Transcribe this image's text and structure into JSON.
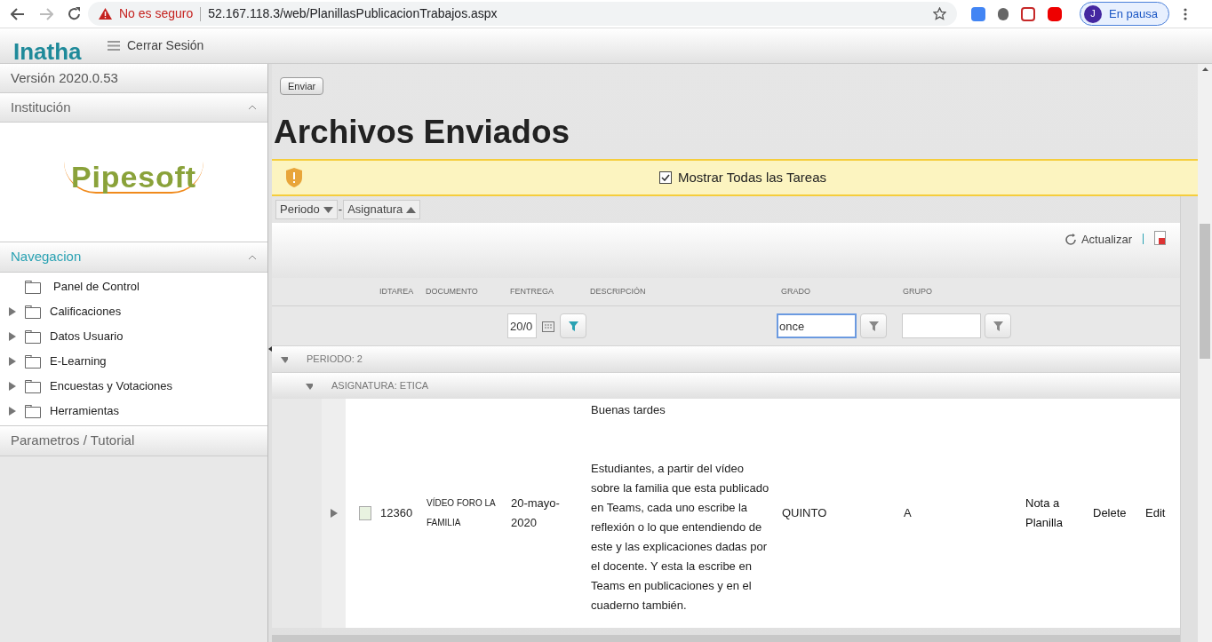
{
  "browser": {
    "security": "No es seguro",
    "url": "52.167.118.3/web/PlanillasPublicacionTrabajos.aspx",
    "profile": {
      "initial": "J",
      "status": "En pausa"
    }
  },
  "app_header": {
    "logo": "Inatha",
    "menu_label": "Cerrar Sesión"
  },
  "sidebar": {
    "version": "Versión 2020.0.53",
    "institution": {
      "title": "Institución",
      "expanded": true,
      "logo": "Pipesoft"
    },
    "navigation": {
      "title": "Navegacion",
      "expanded": true,
      "items": [
        {
          "label": "Panel de Control",
          "has_children": false
        },
        {
          "label": "Calificaciones",
          "has_children": true
        },
        {
          "label": "Datos Usuario",
          "has_children": true
        },
        {
          "label": "E-Learning",
          "has_children": true
        },
        {
          "label": "Encuestas y Votaciones",
          "has_children": true
        },
        {
          "label": "Herramientas",
          "has_children": true
        }
      ]
    },
    "footer_section": "Parametros / Tutorial"
  },
  "send_button": "Enviar",
  "title": "Archivos Enviados",
  "notice": {
    "checkbox_label": "Mostrar Todas las Tareas",
    "checked": true
  },
  "group_chips": [
    {
      "label": "Periodo",
      "ascending": false
    },
    {
      "label": "Asignatura",
      "ascending": true
    }
  ],
  "chip_separator": "-",
  "grid_toolbar": {
    "refresh": "Actualizar"
  },
  "columns": [
    "IDTAREA",
    "DOCUMENTO",
    "FENTREGA",
    "DESCRIPCIÓN",
    "GRADO",
    "GRUPO"
  ],
  "filters": {
    "fentrega": "20/0",
    "grado": "once"
  },
  "groups": [
    {
      "label": "PERIODO: 2",
      "expanded": true
    },
    {
      "label": "ASIGNATURA: ETICA",
      "expanded": true
    }
  ],
  "rows": [
    {
      "id": "12360",
      "documento": "VÍDEO FORO LA FAMILIA",
      "fentrega": "20-mayo-2020",
      "descripcion": [
        "Buenas tardes",
        "Estudiantes, a partir del vídeo sobre la familia que esta publicado en Teams, cada uno escribe la reflexión o lo que entendiendo de este y las explicaciones dadas por el docente. Y esta la escribe en Teams en publicaciones y en el cuaderno también."
      ],
      "grado": "QUINTO",
      "grupo": "A",
      "actions": [
        "Nota a Planilla",
        "Delete",
        "Edit"
      ]
    }
  ]
}
